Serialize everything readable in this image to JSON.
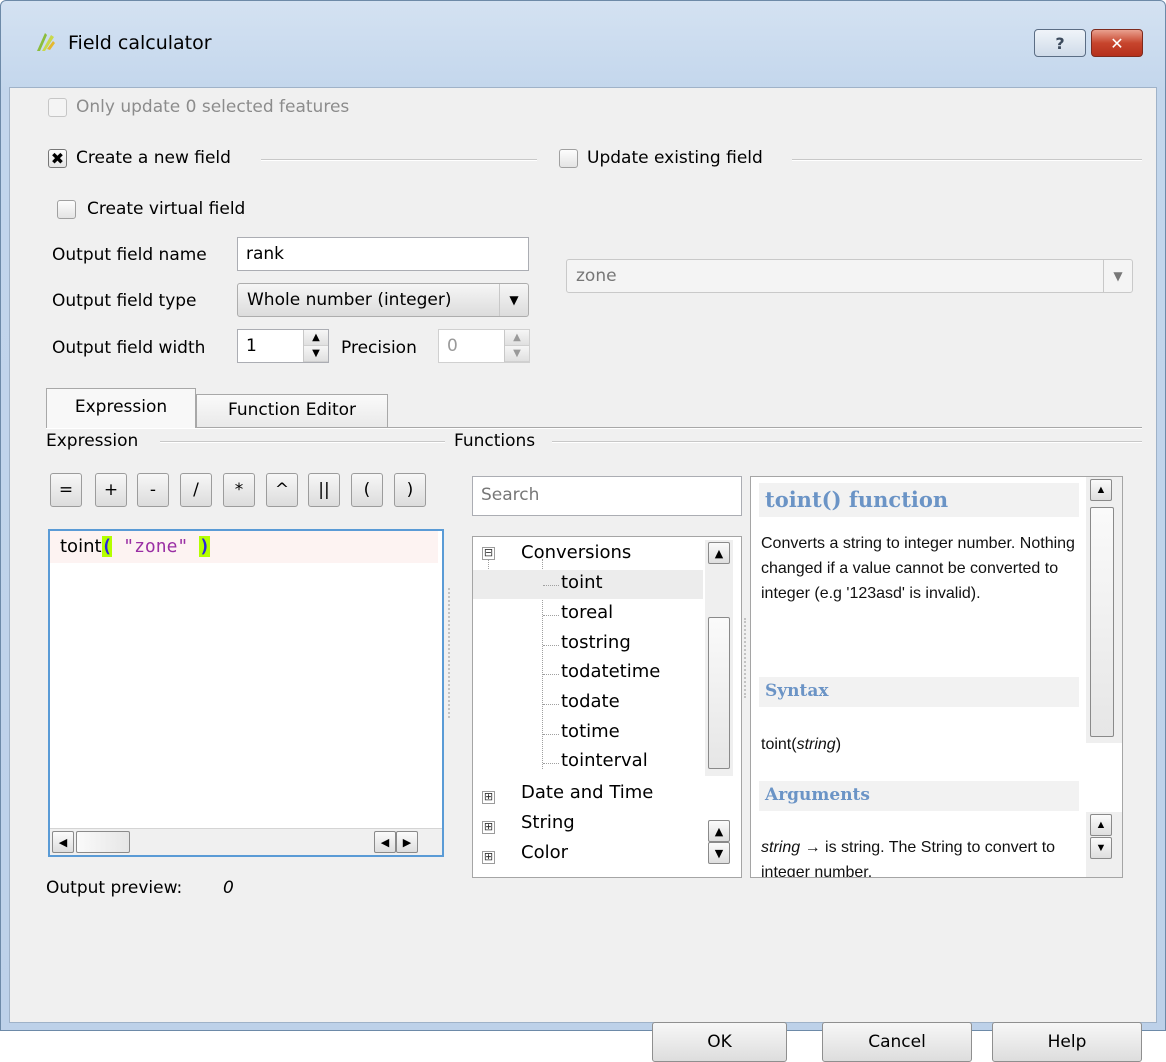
{
  "window": {
    "title": "Field calculator",
    "help_glyph": "?",
    "close_glyph": "✕"
  },
  "only_update": {
    "label": "Only update 0 selected features"
  },
  "create_field": {
    "label": "Create a new field",
    "check_mark": "✖"
  },
  "update_existing": {
    "label": "Update existing field",
    "combo_value": "zone"
  },
  "virtual_field": {
    "label": "Create virtual field"
  },
  "output": {
    "name_label": "Output field name",
    "name_value": "rank",
    "type_label": "Output field type",
    "type_value": "Whole number (integer)",
    "width_label": "Output field width",
    "width_value": "1",
    "precision_label": "Precision",
    "precision_value": "0"
  },
  "tabs": [
    {
      "label": "Expression"
    },
    {
      "label": "Function Editor"
    }
  ],
  "expression_group": {
    "label": "Expression"
  },
  "functions_group": {
    "label": "Functions"
  },
  "operators": [
    "=",
    "+",
    "-",
    "/",
    "*",
    "^",
    "||",
    "(",
    ")"
  ],
  "editor": {
    "fn": "toint",
    "open": "(",
    "arg": " \"zone\" ",
    "close": ")"
  },
  "search": {
    "placeholder": "Search"
  },
  "tree": {
    "groups": [
      {
        "label": "Conversions",
        "expanded": true,
        "items": [
          "toint",
          "toreal",
          "tostring",
          "todatetime",
          "todate",
          "totime",
          "tointerval"
        ]
      },
      {
        "label": "Date and Time"
      },
      {
        "label": "String"
      },
      {
        "label": "Color"
      }
    ],
    "expanded_glyph": "⊟",
    "collapsed_glyph": "⊞"
  },
  "help": {
    "title": "toint() function",
    "description": "Converts a string to integer number. Nothing changed if a value cannot be converted to integer (e.g '123asd' is invalid).",
    "syntax_heading": "Syntax",
    "syntax_fn": "toint(",
    "syntax_arg": "string",
    "syntax_close": ")",
    "arguments_heading": "Arguments",
    "argument_name": "string",
    "argument_arrow": "→",
    "argument_desc": "is string. The String to convert to integer number."
  },
  "preview": {
    "label": "Output preview:",
    "value": "0"
  },
  "buttons": {
    "ok": "OK",
    "cancel": "Cancel",
    "help": "Help"
  },
  "glyphs": {
    "up": "▲",
    "down": "▼",
    "left": "◀",
    "right": "▶"
  }
}
